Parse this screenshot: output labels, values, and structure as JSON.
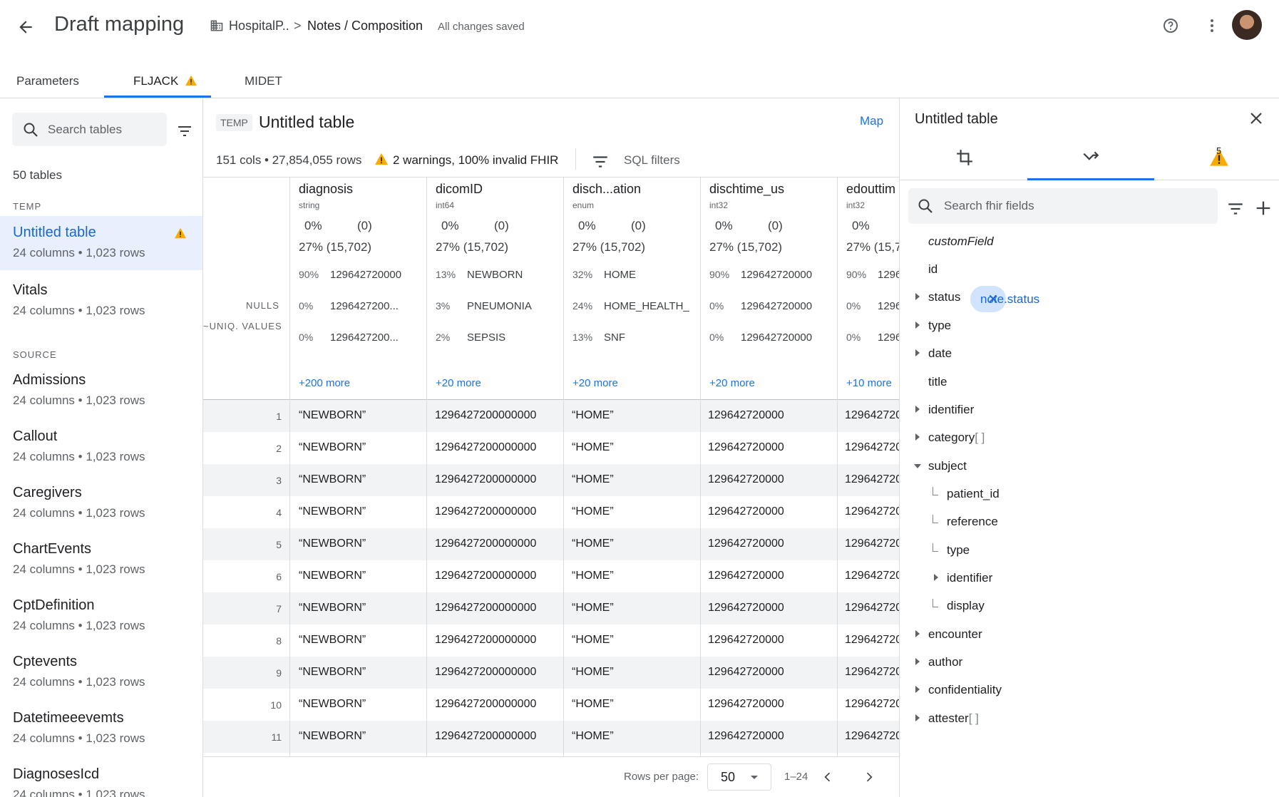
{
  "header": {
    "title": "Draft mapping",
    "breadcrumb_project": "HospitalP..",
    "breadcrumb_separator": ">",
    "breadcrumb_current": "Notes / Composition",
    "save_status": "All changes saved"
  },
  "tabs": [
    {
      "label": "Parameters"
    },
    {
      "label": "FLJACK",
      "warning": true,
      "active": true
    },
    {
      "label": "MIDET"
    }
  ],
  "sidebar": {
    "search_placeholder": "Search tables",
    "tables_count": "50 tables",
    "section_temp": "TEMP",
    "section_source": "SOURCE",
    "temp_tables": [
      {
        "name": "Untitled table",
        "meta": "24 columns • 1,023 rows",
        "warning": true,
        "active": true
      },
      {
        "name": "Vitals",
        "meta": "24 columns • 1,023 rows"
      }
    ],
    "source_tables": [
      {
        "name": "Admissions",
        "meta": "24 columns • 1,023 rows"
      },
      {
        "name": "Callout",
        "meta": "24 columns • 1,023 rows"
      },
      {
        "name": "Caregivers",
        "meta": "24 columns • 1,023 rows"
      },
      {
        "name": "ChartEvents",
        "meta": "24 columns • 1,023 rows"
      },
      {
        "name": "CptDefinition",
        "meta": "24 columns • 1,023 rows"
      },
      {
        "name": "Cptevents",
        "meta": "24 columns • 1,023 rows"
      },
      {
        "name": "Datetimeeevemts",
        "meta": "24 columns • 1,023 rows"
      },
      {
        "name": "DiagnosesIcd",
        "meta": "24 columns • 1,023 rows"
      }
    ]
  },
  "main": {
    "badge": "TEMP",
    "title": "Untitled table",
    "map_label": "Map",
    "stats": "151 cols • 27,854,055 rows",
    "warnings": "2 warnings, 100% invalid FHIR",
    "sql_filters": "SQL filters",
    "label_nulls": "NULLS",
    "label_uniq": "~UNIQ. VALUES",
    "columns": [
      {
        "name": "diagnosis",
        "type": "string",
        "nulls": "0%",
        "nulls_count": "(0)",
        "uniq": "27% (15,702)",
        "top": [
          {
            "pct": "90%",
            "val": "129642720000"
          },
          {
            "pct": "0%",
            "val": "1296427200..."
          },
          {
            "pct": "0%",
            "val": "1296427200..."
          }
        ],
        "more": "+200 more"
      },
      {
        "name": "dicomID",
        "type": "int64",
        "nulls": "0%",
        "nulls_count": "(0)",
        "uniq": "27% (15,702)",
        "top": [
          {
            "pct": "13%",
            "val": "NEWBORN"
          },
          {
            "pct": "3%",
            "val": "PNEUMONIA"
          },
          {
            "pct": "2%",
            "val": "SEPSIS"
          }
        ],
        "more": "+20 more"
      },
      {
        "name": "disch...ation",
        "type": "enum",
        "nulls": "0%",
        "nulls_count": "(0)",
        "uniq": "27% (15,702)",
        "top": [
          {
            "pct": "32%",
            "val": "HOME"
          },
          {
            "pct": "24%",
            "val": "HOME_HEALTH_"
          },
          {
            "pct": "13%",
            "val": "SNF"
          }
        ],
        "more": "+20 more"
      },
      {
        "name": "dischtime_us",
        "type": "int32",
        "nulls": "0%",
        "nulls_count": "(0)",
        "uniq": "27% (15,702)",
        "top": [
          {
            "pct": "90%",
            "val": "129642720000"
          },
          {
            "pct": "0%",
            "val": "129642720000"
          },
          {
            "pct": "0%",
            "val": "129642720000"
          }
        ],
        "more": "+20 more"
      },
      {
        "name": "edouttim",
        "type": "int32",
        "nulls": "0%",
        "nulls_count": "",
        "uniq": "27% (15,7",
        "top": [
          {
            "pct": "90%",
            "val": "1296"
          },
          {
            "pct": "0%",
            "val": "1296"
          },
          {
            "pct": "0%",
            "val": "1296"
          }
        ],
        "more": "+10 more"
      }
    ],
    "rows": [
      {
        "n": "1",
        "c": [
          "“NEWBORN”",
          "1296427200000000",
          "“HOME”",
          "129642720000",
          "129642720"
        ]
      },
      {
        "n": "2",
        "c": [
          "“NEWBORN”",
          "1296427200000000",
          "“HOME”",
          "129642720000",
          "129642720"
        ]
      },
      {
        "n": "3",
        "c": [
          "“NEWBORN”",
          "1296427200000000",
          "“HOME”",
          "129642720000",
          "129642720"
        ]
      },
      {
        "n": "4",
        "c": [
          "“NEWBORN”",
          "1296427200000000",
          "“HOME”",
          "129642720000",
          "129642720"
        ]
      },
      {
        "n": "5",
        "c": [
          "“NEWBORN”",
          "1296427200000000",
          "“HOME”",
          "129642720000",
          "129642720"
        ]
      },
      {
        "n": "6",
        "c": [
          "“NEWBORN”",
          "1296427200000000",
          "“HOME”",
          "129642720000",
          "129642720"
        ]
      },
      {
        "n": "7",
        "c": [
          "“NEWBORN”",
          "1296427200000000",
          "“HOME”",
          "129642720000",
          "129642720"
        ]
      },
      {
        "n": "8",
        "c": [
          "“NEWBORN”",
          "1296427200000000",
          "“HOME”",
          "129642720000",
          "129642720"
        ]
      },
      {
        "n": "9",
        "c": [
          "“NEWBORN”",
          "1296427200000000",
          "“HOME”",
          "129642720000",
          "129642720"
        ]
      },
      {
        "n": "10",
        "c": [
          "“NEWBORN”",
          "1296427200000000",
          "“HOME”",
          "129642720000",
          "129642720"
        ]
      },
      {
        "n": "11",
        "c": [
          "“NEWBORN”",
          "1296427200000000",
          "“HOME”",
          "129642720000",
          "129642720"
        ]
      }
    ],
    "pager": {
      "rows_per_page_label": "Rows per page:",
      "rows_per_page": "50",
      "range": "1–24"
    }
  },
  "panel": {
    "title": "Untitled table",
    "warning_count": "5",
    "search_placeholder": "Search fhir fields",
    "chip": "note.status",
    "fields": [
      {
        "label": "customField",
        "italic": true
      },
      {
        "label": "id"
      },
      {
        "label": "status",
        "expandable": true,
        "chip": true
      },
      {
        "label": "type",
        "expandable": true
      },
      {
        "label": "date",
        "expandable": true
      },
      {
        "label": "title"
      },
      {
        "label": "identifier",
        "expandable": true
      },
      {
        "label": "category",
        "suffix": "[ ]",
        "expandable": true
      },
      {
        "label": "subject",
        "expanded": true
      },
      {
        "label": "patient_id",
        "child": true
      },
      {
        "label": "reference",
        "child": true
      },
      {
        "label": "type",
        "child": true
      },
      {
        "label": "identifier",
        "child": true,
        "expandable": true
      },
      {
        "label": "display",
        "child": true
      },
      {
        "label": "encounter",
        "expandable": true
      },
      {
        "label": "author",
        "expandable": true
      },
      {
        "label": "confidentiality",
        "expandable": true
      },
      {
        "label": "attester",
        "suffix": "[ ]",
        "expandable": true
      }
    ]
  },
  "colors": {
    "accent": "#1a73e8",
    "warning": "#f9ab00",
    "selected_bg": "#e8f0fe",
    "chip_bg": "#d2e3fc"
  }
}
